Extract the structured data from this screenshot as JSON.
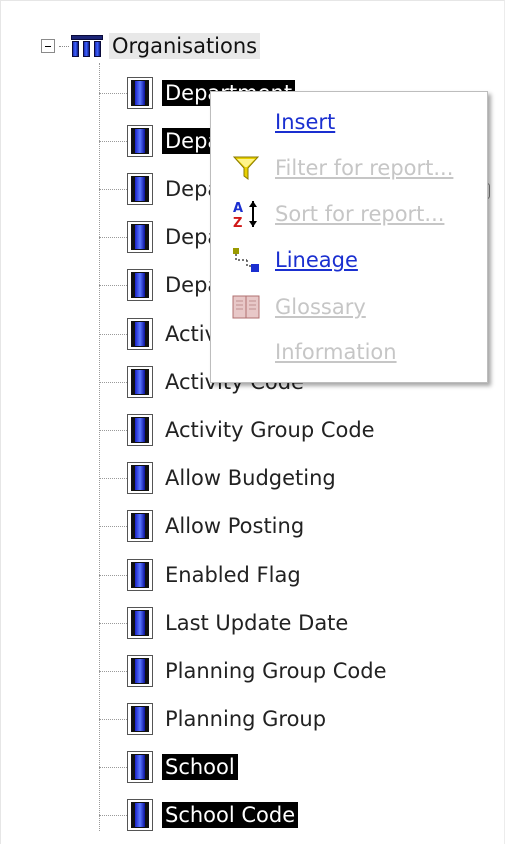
{
  "tree": {
    "root": {
      "label": "Organisations",
      "icon": "table-group-icon",
      "expanded": true
    },
    "items": [
      {
        "label": "Department",
        "selected": true
      },
      {
        "label": "Department",
        "selected": true
      },
      {
        "label": "Department",
        "selected": false
      },
      {
        "label": "Department",
        "selected": false
      },
      {
        "label": "Department",
        "selected": false
      },
      {
        "label": "Activity",
        "selected": false
      },
      {
        "label": "Activity Code",
        "selected": false
      },
      {
        "label": "Activity Group Code",
        "selected": false
      },
      {
        "label": "Allow Budgeting",
        "selected": false
      },
      {
        "label": "Allow Posting",
        "selected": false
      },
      {
        "label": "Enabled Flag",
        "selected": false
      },
      {
        "label": "Last Update Date",
        "selected": false
      },
      {
        "label": "Planning Group Code",
        "selected": false
      },
      {
        "label": "Planning Group",
        "selected": false
      },
      {
        "label": "School",
        "selected": true
      },
      {
        "label": "School Code",
        "selected": true
      }
    ]
  },
  "context_menu": {
    "items": [
      {
        "label": "Insert",
        "enabled": true,
        "icon": ""
      },
      {
        "label": "Filter for report...",
        "enabled": false,
        "icon": "funnel-icon"
      },
      {
        "label": "Sort for report...",
        "enabled": false,
        "icon": "sort-az-icon"
      },
      {
        "label": "Lineage",
        "enabled": true,
        "icon": "lineage-icon"
      },
      {
        "label": "Glossary",
        "enabled": false,
        "icon": "book-icon"
      },
      {
        "label": "Information",
        "enabled": false,
        "icon": ""
      }
    ]
  },
  "colors": {
    "link_enabled": "#1a2fd0",
    "link_disabled": "#c6c6c6",
    "selection_bg": "#000000",
    "selection_fg": "#ffffff"
  }
}
